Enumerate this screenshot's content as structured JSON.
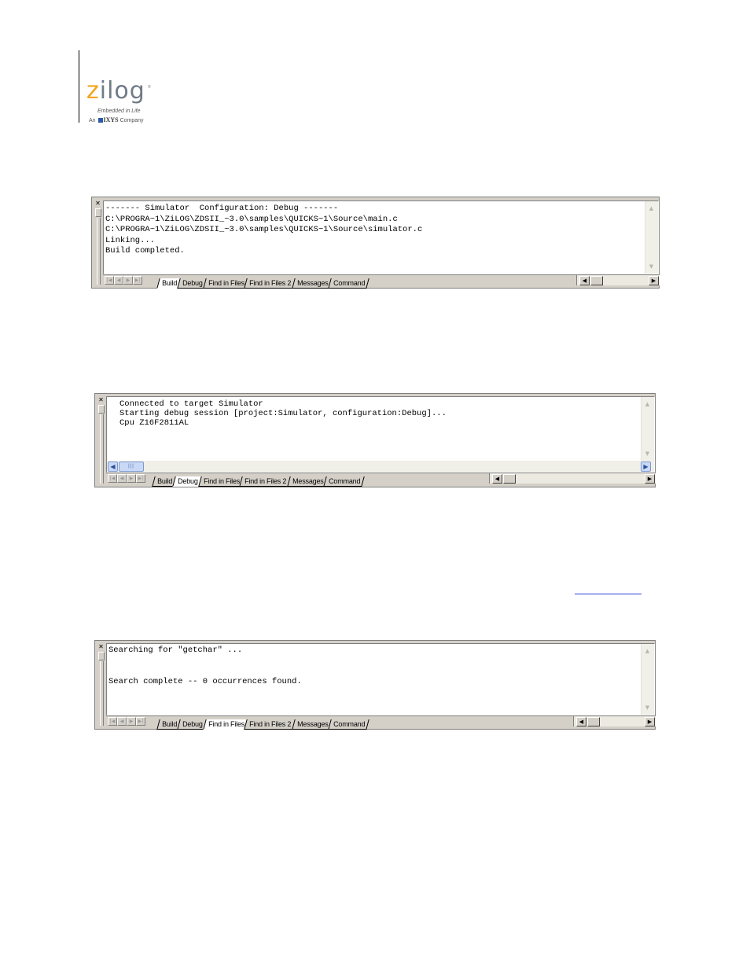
{
  "logo": {
    "wordmark_z": "z",
    "wordmark_rest": "ilog",
    "trademark": "®",
    "tagline": "Embedded in Life",
    "company_prefix": "An",
    "company_brand": "IXYS",
    "company_suffix": "Company",
    "colors": {
      "z": "#f3a51c",
      "text": "#707b86",
      "square": "#2b5aa8"
    }
  },
  "panels": [
    {
      "lines": [
        "------- Simulator  Configuration: Debug -------",
        "C:\\PROGRA~1\\ZiLOG\\ZDSII_~3.0\\samples\\QUICKS~1\\Source\\main.c",
        "C:\\PROGRA~1\\ZiLOG\\ZDSII_~3.0\\samples\\QUICKS~1\\Source\\simulator.c",
        "Linking...",
        "Build completed."
      ],
      "tabs": [
        "Build",
        "Debug",
        "Find in Files",
        "Find in Files 2",
        "Messages",
        "Command"
      ],
      "active_tab": "Build"
    },
    {
      "lines": [
        "Connected to target Simulator",
        "Starting debug session [project:Simulator, configuration:Debug]...",
        "Cpu Z16F2811AL"
      ],
      "tabs": [
        "Build",
        "Debug",
        "Find in Files",
        "Find in Files 2",
        "Messages",
        "Command"
      ],
      "active_tab": "Debug"
    },
    {
      "lines": [
        "Searching for \"getchar\" ...",
        "",
        "",
        "Search complete -- 0 occurrences found."
      ],
      "tabs": [
        "Build",
        "Debug",
        "Find in Files",
        "Find in Files 2",
        "Messages",
        "Command"
      ],
      "active_tab": "Find in Files"
    }
  ],
  "icons": {
    "close": "close-icon",
    "nav_first": "nav-first-icon",
    "nav_prev": "nav-prev-icon",
    "nav_next": "nav-next-icon",
    "nav_last": "nav-last-icon",
    "scroll_up": "arrow-up-icon",
    "scroll_down": "arrow-down-icon",
    "scroll_left": "arrow-left-icon",
    "scroll_right": "arrow-right-icon"
  }
}
